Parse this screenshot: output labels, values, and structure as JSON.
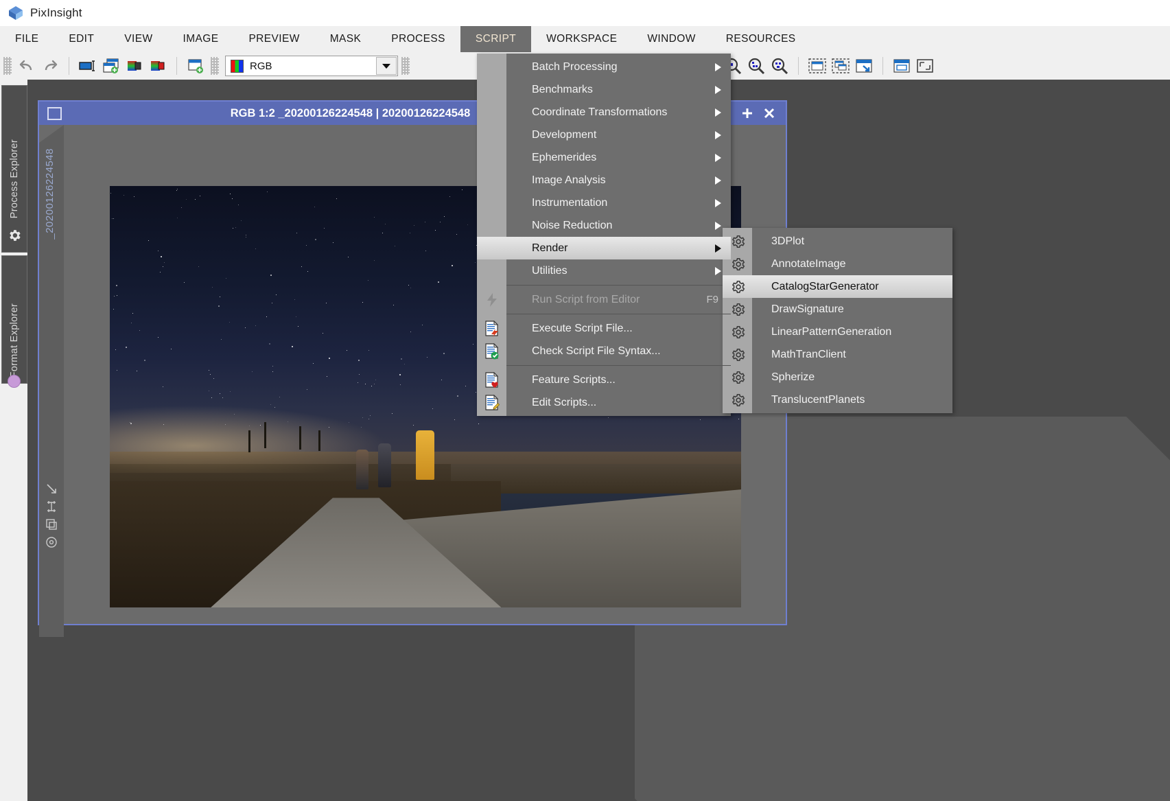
{
  "app": {
    "title": "PixInsight",
    "logo_icon": "pixinsight-cube-icon"
  },
  "menubar": {
    "items": [
      {
        "label": "FILE",
        "active": false
      },
      {
        "label": "EDIT",
        "active": false
      },
      {
        "label": "VIEW",
        "active": false
      },
      {
        "label": "IMAGE",
        "active": false
      },
      {
        "label": "PREVIEW",
        "active": false
      },
      {
        "label": "MASK",
        "active": false
      },
      {
        "label": "PROCESS",
        "active": false
      },
      {
        "label": "SCRIPT",
        "active": true
      },
      {
        "label": "WORKSPACE",
        "active": false
      },
      {
        "label": "WINDOW",
        "active": false
      },
      {
        "label": "RESOURCES",
        "active": false
      }
    ]
  },
  "toolbar": {
    "undo_icon": "undo-icon",
    "redo_icon": "redo-icon",
    "rename_icon": "rename-view-icon",
    "duplicate_icon": "duplicate-window-icon",
    "extract_icon": "extract-channel-icon",
    "extract2_icon": "extract-channel-alt-icon",
    "newwindow_icon": "new-window-icon",
    "view_selector": {
      "value": "RGB",
      "swatch": "rgb-channel-swatch",
      "arrow_icon": "chevron-down-icon"
    },
    "zoom_in_icon": "zoom-in-icon",
    "zoom_out_icon": "zoom-out-icon",
    "zoom_1_1_icon": "zoom-actual-icon",
    "zoom_fit_icon": "zoom-fit-icon",
    "zoom_optimal_icon": "zoom-optimal-icon",
    "fit_window_icon": "fit-window-icon",
    "fit_all_icon": "fit-all-windows-icon",
    "maximize_icon": "maximize-window-icon",
    "screen_fit_icon": "screen-fit-icon",
    "expand_icon": "expand-window-icon"
  },
  "left_dock": {
    "tabs": [
      {
        "label": "Process Explorer",
        "icon": "gear-icon"
      },
      {
        "label": "Format Explorer",
        "icon": "format-icon"
      }
    ],
    "indicator_dot": "history-explorer-dot"
  },
  "image_window": {
    "restore_icon": "restore-window-icon",
    "title": "RGB 1:2 _20200126224548 | 20200126224548",
    "buttons": [
      {
        "icon": "collapse-icon"
      },
      {
        "icon": "maximize-plus-icon"
      },
      {
        "icon": "close-x-icon"
      }
    ],
    "vertical_tab_label": "_20200126224548",
    "corner_tools": [
      {
        "icon": "resize-arrow-icon"
      },
      {
        "icon": "crosshair-icon"
      },
      {
        "icon": "copy-preview-icon"
      },
      {
        "icon": "target-icon"
      }
    ]
  },
  "script_menu": {
    "items": [
      {
        "label": "Batch Processing",
        "type": "submenu",
        "icon": "",
        "shortcut": "",
        "disabled": false,
        "highlighted": false
      },
      {
        "label": "Benchmarks",
        "type": "submenu",
        "icon": "",
        "shortcut": "",
        "disabled": false,
        "highlighted": false
      },
      {
        "label": "Coordinate Transformations",
        "type": "submenu",
        "icon": "",
        "shortcut": "",
        "disabled": false,
        "highlighted": false
      },
      {
        "label": "Development",
        "type": "submenu",
        "icon": "",
        "shortcut": "",
        "disabled": false,
        "highlighted": false
      },
      {
        "label": "Ephemerides",
        "type": "submenu",
        "icon": "",
        "shortcut": "",
        "disabled": false,
        "highlighted": false
      },
      {
        "label": "Image Analysis",
        "type": "submenu",
        "icon": "",
        "shortcut": "",
        "disabled": false,
        "highlighted": false
      },
      {
        "label": "Instrumentation",
        "type": "submenu",
        "icon": "",
        "shortcut": "",
        "disabled": false,
        "highlighted": false
      },
      {
        "label": "Noise Reduction",
        "type": "submenu",
        "icon": "",
        "shortcut": "",
        "disabled": false,
        "highlighted": false
      },
      {
        "label": "Render",
        "type": "submenu",
        "icon": "",
        "shortcut": "",
        "disabled": false,
        "highlighted": true
      },
      {
        "label": "Utilities",
        "type": "submenu",
        "icon": "",
        "shortcut": "",
        "disabled": false,
        "highlighted": false
      },
      {
        "label": "__separator__",
        "type": "separator"
      },
      {
        "label": "Run Script from Editor",
        "type": "action",
        "icon": "lightning-icon",
        "shortcut": "F9",
        "disabled": true,
        "highlighted": false
      },
      {
        "label": "__separator__",
        "type": "separator"
      },
      {
        "label": "Execute Script File...",
        "type": "action",
        "icon": "script-run-icon",
        "shortcut": "",
        "disabled": false,
        "highlighted": false
      },
      {
        "label": "Check Script File Syntax...",
        "type": "action",
        "icon": "script-check-icon",
        "shortcut": "",
        "disabled": false,
        "highlighted": false
      },
      {
        "label": "__separator__",
        "type": "separator"
      },
      {
        "label": "Feature Scripts...",
        "type": "action",
        "icon": "script-heart-icon",
        "shortcut": "",
        "disabled": false,
        "highlighted": false
      },
      {
        "label": "Edit Scripts...",
        "type": "action",
        "icon": "script-edit-icon",
        "shortcut": "",
        "disabled": false,
        "highlighted": false
      }
    ]
  },
  "render_menu": {
    "items": [
      {
        "label": "3DPlot",
        "icon": "gear-icon",
        "highlighted": false
      },
      {
        "label": "AnnotateImage",
        "icon": "gear-icon",
        "highlighted": false
      },
      {
        "label": "CatalogStarGenerator",
        "icon": "gear-icon",
        "highlighted": true
      },
      {
        "label": "DrawSignature",
        "icon": "gear-icon",
        "highlighted": false
      },
      {
        "label": "LinearPatternGeneration",
        "icon": "gear-icon",
        "highlighted": false
      },
      {
        "label": "MathTranClient",
        "icon": "gear-icon",
        "highlighted": false
      },
      {
        "label": "Spherize",
        "icon": "gear-icon",
        "highlighted": false
      },
      {
        "label": "TranslucentPlanets",
        "icon": "gear-icon",
        "highlighted": false
      }
    ]
  },
  "colors": {
    "menu_bg": "#6e6e6e",
    "menu_gutter": "#a8a8a8",
    "highlight": "#d8d8d8",
    "title_active": "#5b6bb5",
    "window_border": "#6f7fd0",
    "workspace": "#4a4a4a",
    "toolbar_bg": "#f0f0f0",
    "script_tab_bg": "#6e6e6e"
  }
}
